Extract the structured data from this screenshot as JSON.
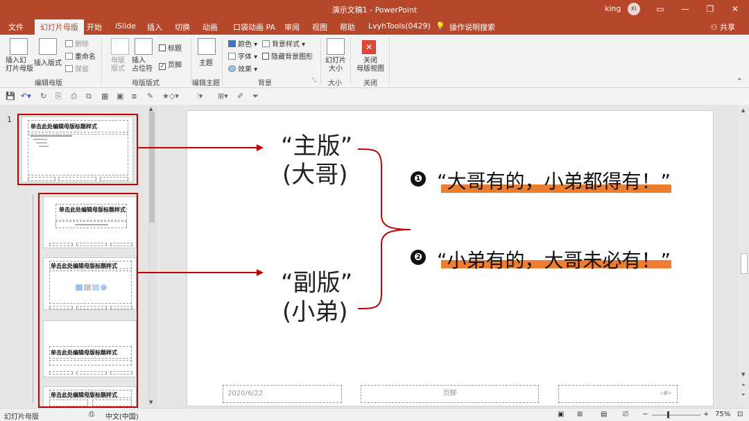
{
  "window": {
    "title": "演示文稿1  -  PowerPoint",
    "user": "king",
    "avatar": "KI",
    "buttons": [
      "ribbon-display-icon",
      "minimize-icon",
      "restore-icon",
      "close-icon"
    ]
  },
  "tabs": [
    "文件",
    "幻灯片母版",
    "开始",
    "iSlide",
    "插入",
    "切换",
    "动画",
    "口袋动画 PA",
    "审阅",
    "视图",
    "帮助",
    "LvyhTools(0429)",
    "操作说明搜索"
  ],
  "share_label": "共享",
  "ribbon": {
    "insert_master": "插入幻\n灯片母版",
    "insert_layout": "插入版式",
    "delete": "删除",
    "rename": "重命名",
    "preserve": "保留",
    "master_layout": "母版\n版式",
    "insert_placeholder": "插入\n占位符",
    "title_check": "标题",
    "footer_check": "页脚",
    "theme": "主题",
    "colors": "颜色",
    "fonts": "字体",
    "effects": "效果",
    "bg_styles": "背景样式",
    "hide_bg": "隐藏背景图形",
    "slide_size": "幻灯片\n大小",
    "close_master": "关闭\n母版视图",
    "groups": [
      "编辑母版",
      "母版版式",
      "编辑主题",
      "背景",
      "大小",
      "关闭"
    ]
  },
  "thumbnails": {
    "slide_number": "1",
    "master_title": "单击此处编辑母版标题样式",
    "layout1_title": "单击此处编辑母版标题样式",
    "layout2_title": "单击此处编辑母版标题样式",
    "layout3_title": "单击此处编辑母版标题样式",
    "layout4_title": "单击此处编辑母版标题样式"
  },
  "slide": {
    "master_label": "“主版”",
    "master_sub": "(大哥)",
    "sub_label": "“副版”",
    "sub_sub": "(小弟)",
    "bullet1": "❶",
    "bullet2": "❷",
    "quote1": "“大哥有的，小弟都得有！”",
    "quote2": "“小弟有的，大哥未必有！”",
    "footer_date": "2020/6/22",
    "footer_text": "页脚",
    "footer_num": "‹#›"
  },
  "statusbar": {
    "view": "幻灯片母版",
    "language": "中文(中国)",
    "zoom": "75%"
  },
  "colors": {
    "accent": "#b7472a",
    "highlight": "#ed7d31",
    "selection": "#c00000"
  }
}
